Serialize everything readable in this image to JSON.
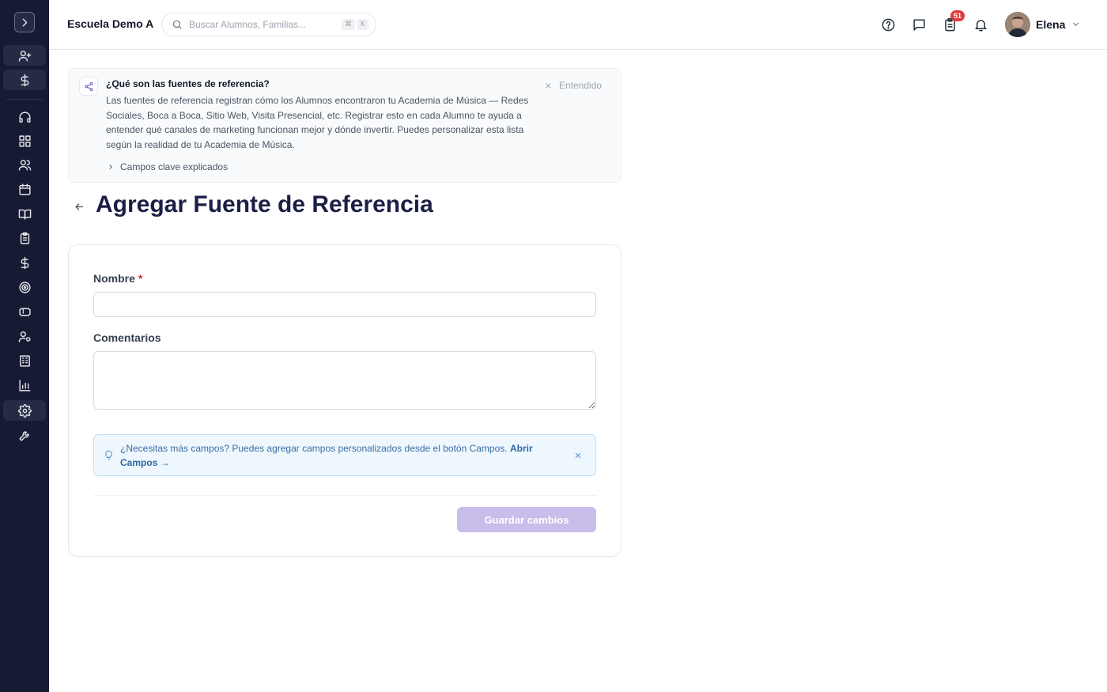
{
  "topbar": {
    "school_name": "Escuela Demo A",
    "search_placeholder": "Buscar Alumnos, Familias...",
    "search_shortcut": [
      "⌘",
      "K"
    ],
    "tasks_badge": "51",
    "user_name": "Elena"
  },
  "sidebar": {
    "icons": [
      "chevron-right-icon",
      "user-plus-icon",
      "dollar-icon",
      "headset-icon",
      "grid-icon",
      "users-icon",
      "calendar-icon",
      "book-open-icon",
      "clipboard-icon",
      "dollar-icon",
      "target-icon",
      "ticket-icon",
      "user-cog-icon",
      "building-icon",
      "bar-chart-icon",
      "settings-icon",
      "wrench-icon"
    ],
    "active": "settings-icon"
  },
  "info_panel": {
    "title": "¿Qué son las fuentes de referencia?",
    "body": "Las fuentes de referencia registran cómo los Alumnos encontraron tu Academia de Música — Redes Sociales, Boca a Boca, Sitio Web, Visita Presencial, etc. Registrar esto en cada Alumno te ayuda a entender qué canales de marketing funcionan mejor y dónde invertir. Puedes personalizar esta lista según la realidad de tu Academia de Música.",
    "dismiss_label": "Entendido",
    "expand_label": "Campos clave explicados"
  },
  "page": {
    "title": "Agregar Fuente de Referencia"
  },
  "form": {
    "name_label": "Nombre",
    "name_required": "*",
    "name_value": "",
    "comments_label": "Comentarios",
    "comments_value": "",
    "tip_text": "¿Necesitas más campos? Puedes agregar campos personalizados desde el botón Campos.",
    "tip_link": "Abrir Campos →",
    "save_label": "Guardar cambios"
  },
  "colors": {
    "sidebar_bg": "#161a33",
    "title": "#1b1f46",
    "save_disabled": "#c9bde9",
    "badge": "#e23b3b",
    "tip_bg": "#eef7fd"
  }
}
